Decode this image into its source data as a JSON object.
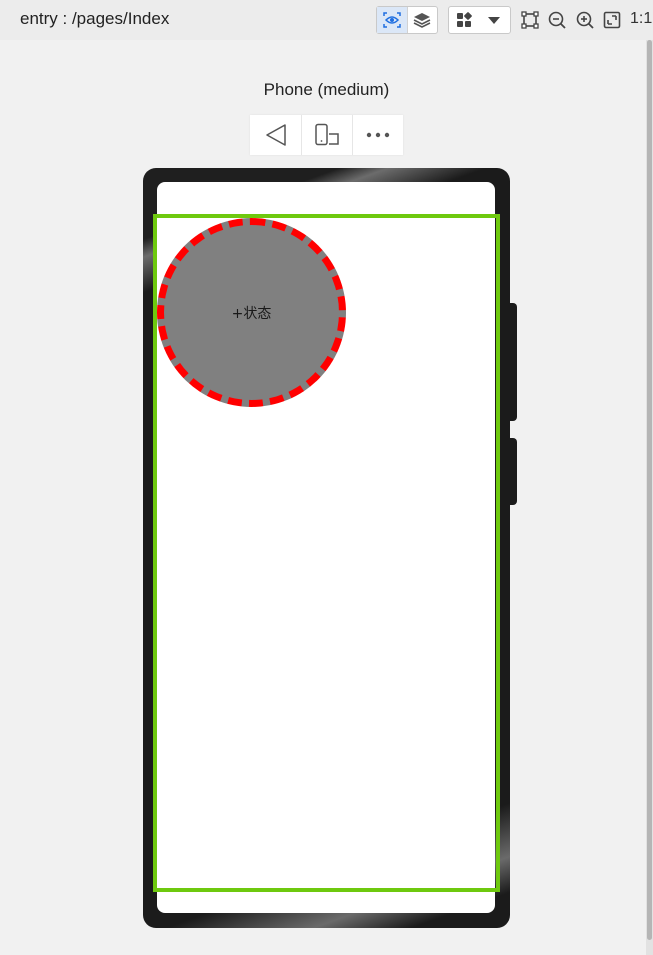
{
  "header": {
    "path": "entry : /pages/Index",
    "ratio": "1:1"
  },
  "toolbar": {
    "icons": [
      "eye-icon",
      "layers-icon",
      "grid-icon",
      "dropdown-arrow-icon",
      "crop-icon",
      "zoom-out-icon",
      "zoom-in-icon",
      "fit-screen-icon"
    ],
    "accent": "#1f6fe0"
  },
  "preview": {
    "device_name": "Phone (medium)",
    "device_toolbar": [
      "rotate-back-icon",
      "device-rotate-icon",
      "more-icon"
    ]
  },
  "app": {
    "circle_label": "+状态",
    "frame_color": "#6ec90e",
    "circle_color": "#808080",
    "circle_border_color": "#ff0000"
  }
}
